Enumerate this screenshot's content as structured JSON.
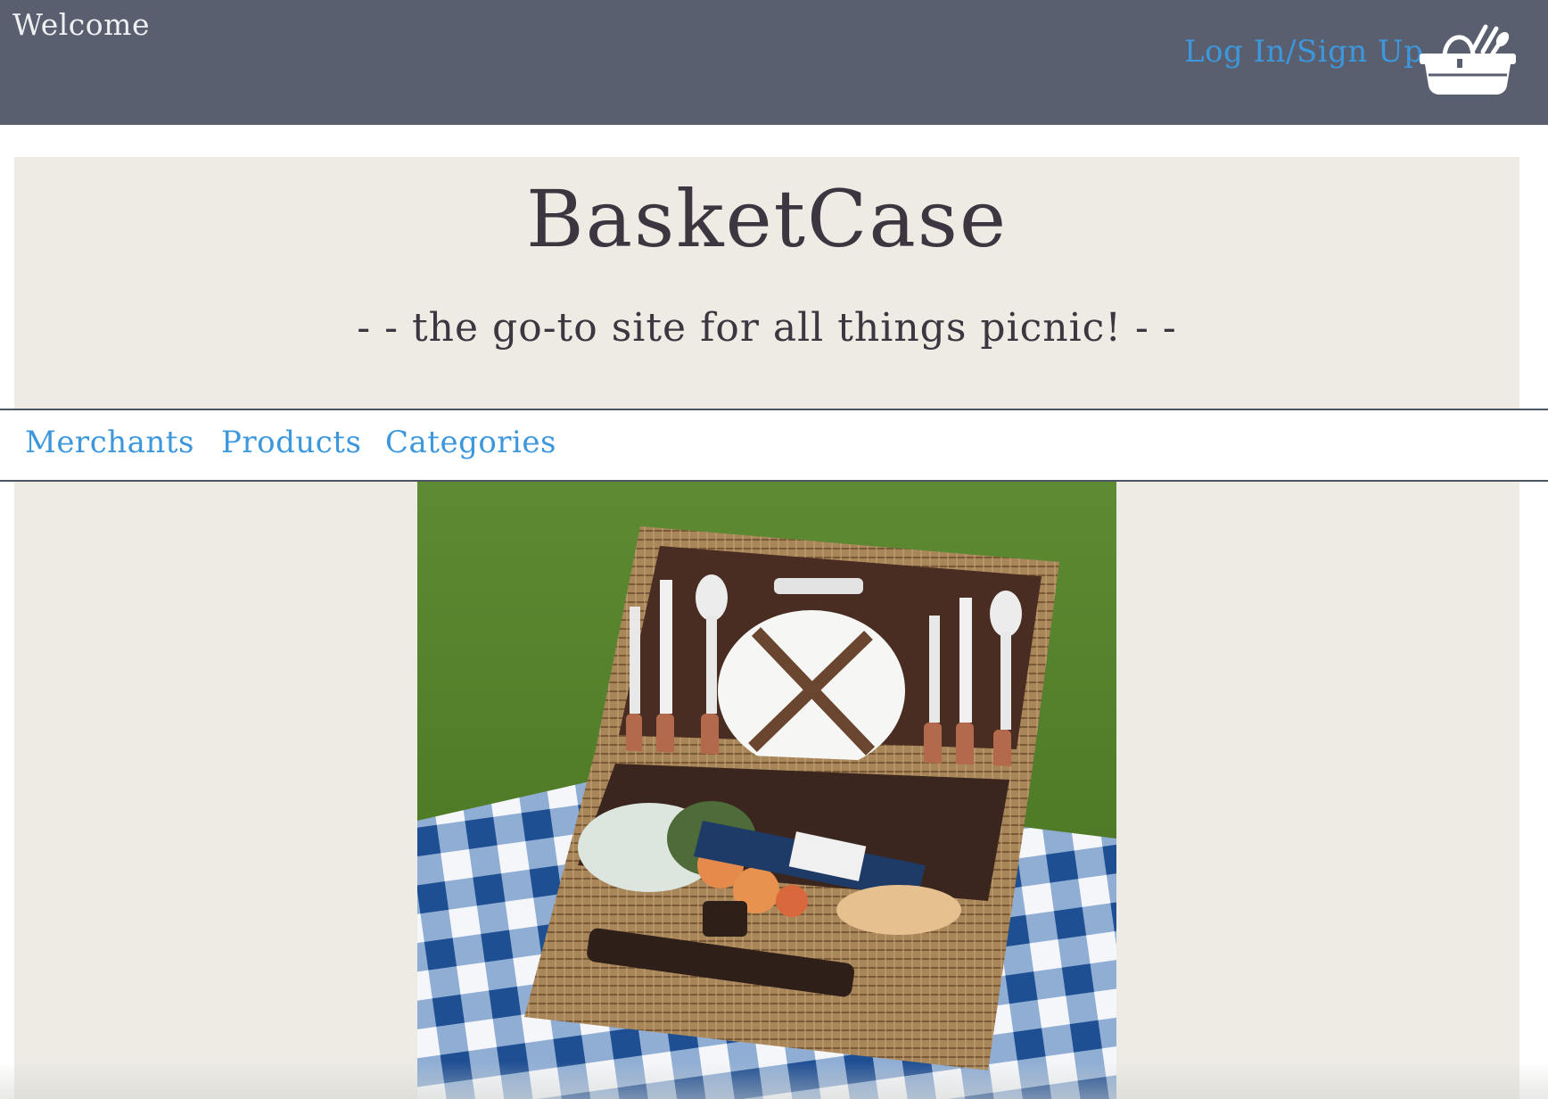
{
  "header": {
    "welcome_text": "Welcome",
    "login_label": "Log In/Sign Up",
    "cart_icon": "picnic-basket-icon",
    "background_color": "#5a5f70",
    "link_color": "#3c97dd"
  },
  "hero": {
    "title": "BasketCase",
    "tagline": "- - the go-to site for all things picnic! - -",
    "background_color": "#edebe4"
  },
  "nav": {
    "items": [
      {
        "label": "Merchants"
      },
      {
        "label": "Products"
      },
      {
        "label": "Categories"
      }
    ]
  },
  "main": {
    "image": "picnic-basket-photo"
  }
}
